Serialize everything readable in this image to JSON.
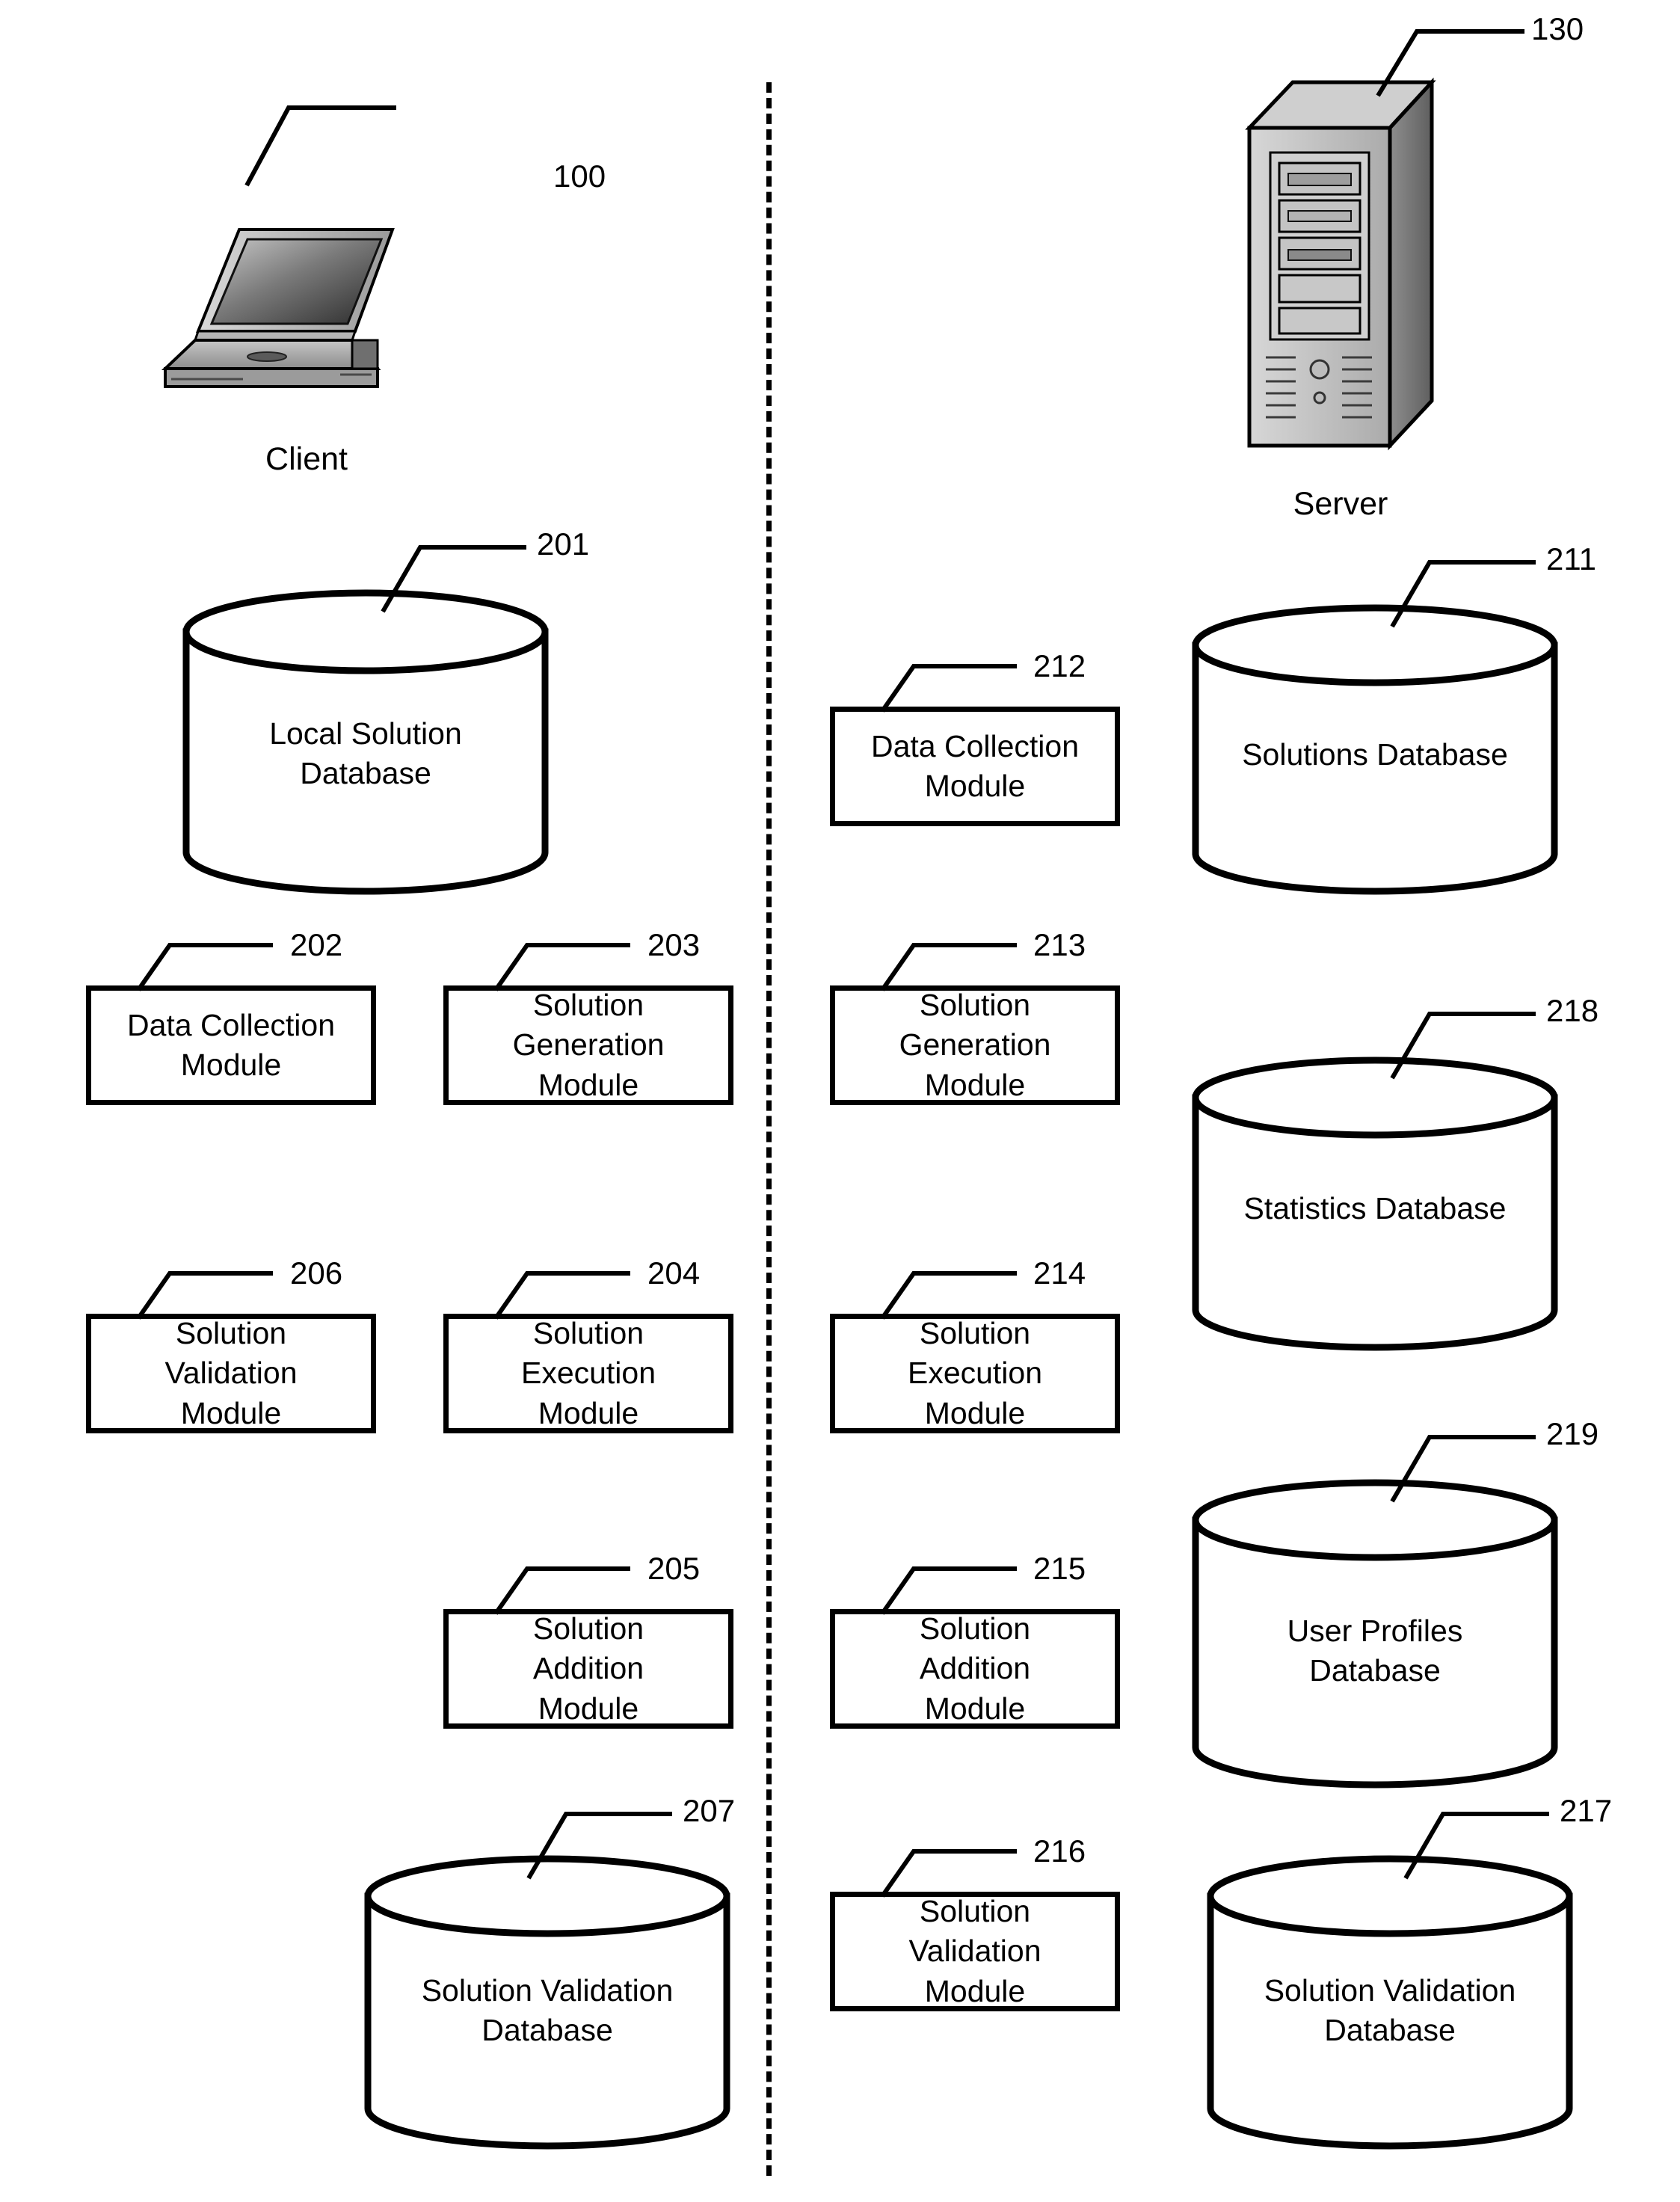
{
  "figure": {
    "title": "Client-Server Solution System Block Diagram",
    "divider": "dashed-vertical-separator"
  },
  "client_side": {
    "caption": "Client",
    "device_ref": "100",
    "device_icon": "laptop-icon",
    "nodes": [
      {
        "ref": "201",
        "label": "Local Solution\nDatabase",
        "shape": "cylinder"
      },
      {
        "ref": "202",
        "label": "Data Collection\nModule",
        "shape": "rect"
      },
      {
        "ref": "203",
        "label": "Solution\nGeneration\nModule",
        "shape": "rect"
      },
      {
        "ref": "206",
        "label": "Solution\nValidation\nModule",
        "shape": "rect"
      },
      {
        "ref": "204",
        "label": "Solution\nExecution\nModule",
        "shape": "rect"
      },
      {
        "ref": "205",
        "label": "Solution\nAddition\nModule",
        "shape": "rect"
      },
      {
        "ref": "207",
        "label": "Solution Validation\nDatabase",
        "shape": "cylinder"
      }
    ]
  },
  "server_side": {
    "caption": "Server",
    "device_ref": "130",
    "device_icon": "server-tower-icon",
    "nodes": [
      {
        "ref": "212",
        "label": "Data Collection\nModule",
        "shape": "rect"
      },
      {
        "ref": "213",
        "label": "Solution\nGeneration\nModule",
        "shape": "rect"
      },
      {
        "ref": "214",
        "label": "Solution\nExecution\nModule",
        "shape": "rect"
      },
      {
        "ref": "215",
        "label": "Solution\nAddition\nModule",
        "shape": "rect"
      },
      {
        "ref": "216",
        "label": "Solution\nValidation\nModule",
        "shape": "rect"
      },
      {
        "ref": "211",
        "label": "Solutions Database",
        "shape": "cylinder"
      },
      {
        "ref": "218",
        "label": "Statistics Database",
        "shape": "cylinder"
      },
      {
        "ref": "219",
        "label": "User Profiles\nDatabase",
        "shape": "cylinder"
      },
      {
        "ref": "217",
        "label": "Solution Validation\nDatabase",
        "shape": "cylinder"
      }
    ]
  },
  "colors": {
    "stroke": "#000000",
    "fill": "#ffffff",
    "background": "#ffffff"
  }
}
